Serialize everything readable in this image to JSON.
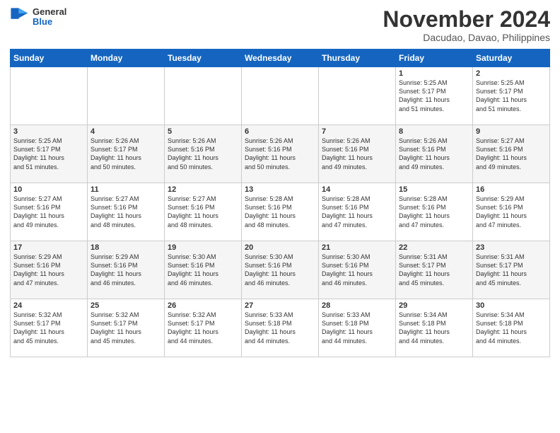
{
  "logo": {
    "line1": "General",
    "line2": "Blue"
  },
  "title": "November 2024",
  "location": "Dacudao, Davao, Philippines",
  "weekdays": [
    "Sunday",
    "Monday",
    "Tuesday",
    "Wednesday",
    "Thursday",
    "Friday",
    "Saturday"
  ],
  "weeks": [
    [
      {
        "day": "",
        "info": ""
      },
      {
        "day": "",
        "info": ""
      },
      {
        "day": "",
        "info": ""
      },
      {
        "day": "",
        "info": ""
      },
      {
        "day": "",
        "info": ""
      },
      {
        "day": "1",
        "info": "Sunrise: 5:25 AM\nSunset: 5:17 PM\nDaylight: 11 hours\nand 51 minutes."
      },
      {
        "day": "2",
        "info": "Sunrise: 5:25 AM\nSunset: 5:17 PM\nDaylight: 11 hours\nand 51 minutes."
      }
    ],
    [
      {
        "day": "3",
        "info": "Sunrise: 5:25 AM\nSunset: 5:17 PM\nDaylight: 11 hours\nand 51 minutes."
      },
      {
        "day": "4",
        "info": "Sunrise: 5:26 AM\nSunset: 5:17 PM\nDaylight: 11 hours\nand 50 minutes."
      },
      {
        "day": "5",
        "info": "Sunrise: 5:26 AM\nSunset: 5:16 PM\nDaylight: 11 hours\nand 50 minutes."
      },
      {
        "day": "6",
        "info": "Sunrise: 5:26 AM\nSunset: 5:16 PM\nDaylight: 11 hours\nand 50 minutes."
      },
      {
        "day": "7",
        "info": "Sunrise: 5:26 AM\nSunset: 5:16 PM\nDaylight: 11 hours\nand 49 minutes."
      },
      {
        "day": "8",
        "info": "Sunrise: 5:26 AM\nSunset: 5:16 PM\nDaylight: 11 hours\nand 49 minutes."
      },
      {
        "day": "9",
        "info": "Sunrise: 5:27 AM\nSunset: 5:16 PM\nDaylight: 11 hours\nand 49 minutes."
      }
    ],
    [
      {
        "day": "10",
        "info": "Sunrise: 5:27 AM\nSunset: 5:16 PM\nDaylight: 11 hours\nand 49 minutes."
      },
      {
        "day": "11",
        "info": "Sunrise: 5:27 AM\nSunset: 5:16 PM\nDaylight: 11 hours\nand 48 minutes."
      },
      {
        "day": "12",
        "info": "Sunrise: 5:27 AM\nSunset: 5:16 PM\nDaylight: 11 hours\nand 48 minutes."
      },
      {
        "day": "13",
        "info": "Sunrise: 5:28 AM\nSunset: 5:16 PM\nDaylight: 11 hours\nand 48 minutes."
      },
      {
        "day": "14",
        "info": "Sunrise: 5:28 AM\nSunset: 5:16 PM\nDaylight: 11 hours\nand 47 minutes."
      },
      {
        "day": "15",
        "info": "Sunrise: 5:28 AM\nSunset: 5:16 PM\nDaylight: 11 hours\nand 47 minutes."
      },
      {
        "day": "16",
        "info": "Sunrise: 5:29 AM\nSunset: 5:16 PM\nDaylight: 11 hours\nand 47 minutes."
      }
    ],
    [
      {
        "day": "17",
        "info": "Sunrise: 5:29 AM\nSunset: 5:16 PM\nDaylight: 11 hours\nand 47 minutes."
      },
      {
        "day": "18",
        "info": "Sunrise: 5:29 AM\nSunset: 5:16 PM\nDaylight: 11 hours\nand 46 minutes."
      },
      {
        "day": "19",
        "info": "Sunrise: 5:30 AM\nSunset: 5:16 PM\nDaylight: 11 hours\nand 46 minutes."
      },
      {
        "day": "20",
        "info": "Sunrise: 5:30 AM\nSunset: 5:16 PM\nDaylight: 11 hours\nand 46 minutes."
      },
      {
        "day": "21",
        "info": "Sunrise: 5:30 AM\nSunset: 5:16 PM\nDaylight: 11 hours\nand 46 minutes."
      },
      {
        "day": "22",
        "info": "Sunrise: 5:31 AM\nSunset: 5:17 PM\nDaylight: 11 hours\nand 45 minutes."
      },
      {
        "day": "23",
        "info": "Sunrise: 5:31 AM\nSunset: 5:17 PM\nDaylight: 11 hours\nand 45 minutes."
      }
    ],
    [
      {
        "day": "24",
        "info": "Sunrise: 5:32 AM\nSunset: 5:17 PM\nDaylight: 11 hours\nand 45 minutes."
      },
      {
        "day": "25",
        "info": "Sunrise: 5:32 AM\nSunset: 5:17 PM\nDaylight: 11 hours\nand 45 minutes."
      },
      {
        "day": "26",
        "info": "Sunrise: 5:32 AM\nSunset: 5:17 PM\nDaylight: 11 hours\nand 44 minutes."
      },
      {
        "day": "27",
        "info": "Sunrise: 5:33 AM\nSunset: 5:18 PM\nDaylight: 11 hours\nand 44 minutes."
      },
      {
        "day": "28",
        "info": "Sunrise: 5:33 AM\nSunset: 5:18 PM\nDaylight: 11 hours\nand 44 minutes."
      },
      {
        "day": "29",
        "info": "Sunrise: 5:34 AM\nSunset: 5:18 PM\nDaylight: 11 hours\nand 44 minutes."
      },
      {
        "day": "30",
        "info": "Sunrise: 5:34 AM\nSunset: 5:18 PM\nDaylight: 11 hours\nand 44 minutes."
      }
    ]
  ]
}
